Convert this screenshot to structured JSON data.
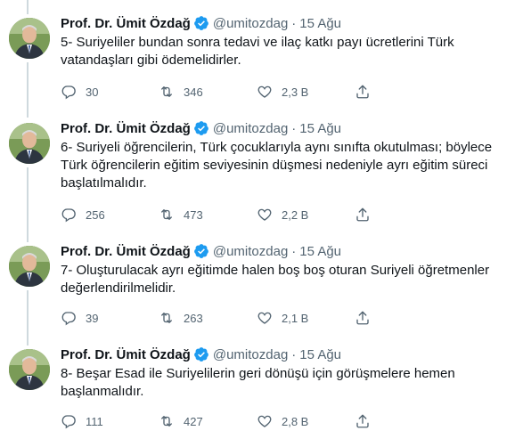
{
  "colors": {
    "accent": "#1d9bf0",
    "text": "#0f1419",
    "muted": "#536471",
    "thread": "#cfd9de"
  },
  "tweets": [
    {
      "name": "Prof. Dr. Ümit Özdağ",
      "handle": "@umitozdag",
      "sep": "·",
      "date": "15 Ağu",
      "text": "5- Suriyeliler bundan sonra tedavi ve ilaç katkı payı ücretlerini Türk vatandaşları gibi ödemelidirler.",
      "replies": "30",
      "retweets": "346",
      "likes": "2,3 B"
    },
    {
      "name": "Prof. Dr. Ümit Özdağ",
      "handle": "@umitozdag",
      "sep": "·",
      "date": "15 Ağu",
      "text": "6- Suriyeli öğrencilerin, Türk çocuklarıyla aynı sınıfta okutulması; böylece Türk öğrencilerin eğitim seviyesinin düşmesi nedeniyle ayrı eğitim süreci başlatılmalıdır.",
      "replies": "256",
      "retweets": "473",
      "likes": "2,2 B"
    },
    {
      "name": "Prof. Dr. Ümit Özdağ",
      "handle": "@umitozdag",
      "sep": "·",
      "date": "15 Ağu",
      "text": "7- Oluşturulacak ayrı eğitimde halen boş boş oturan Suriyeli öğretmenler değerlendirilmelidir.",
      "replies": "39",
      "retweets": "263",
      "likes": "2,1 B"
    },
    {
      "name": "Prof. Dr. Ümit Özdağ",
      "handle": "@umitozdag",
      "sep": "·",
      "date": "15 Ağu",
      "text": "8- Beşar Esad ile Suriyelilerin geri dönüşü için görüşmelere hemen başlanmalıdır.",
      "replies": "111",
      "retweets": "427",
      "likes": "2,8 B"
    }
  ]
}
